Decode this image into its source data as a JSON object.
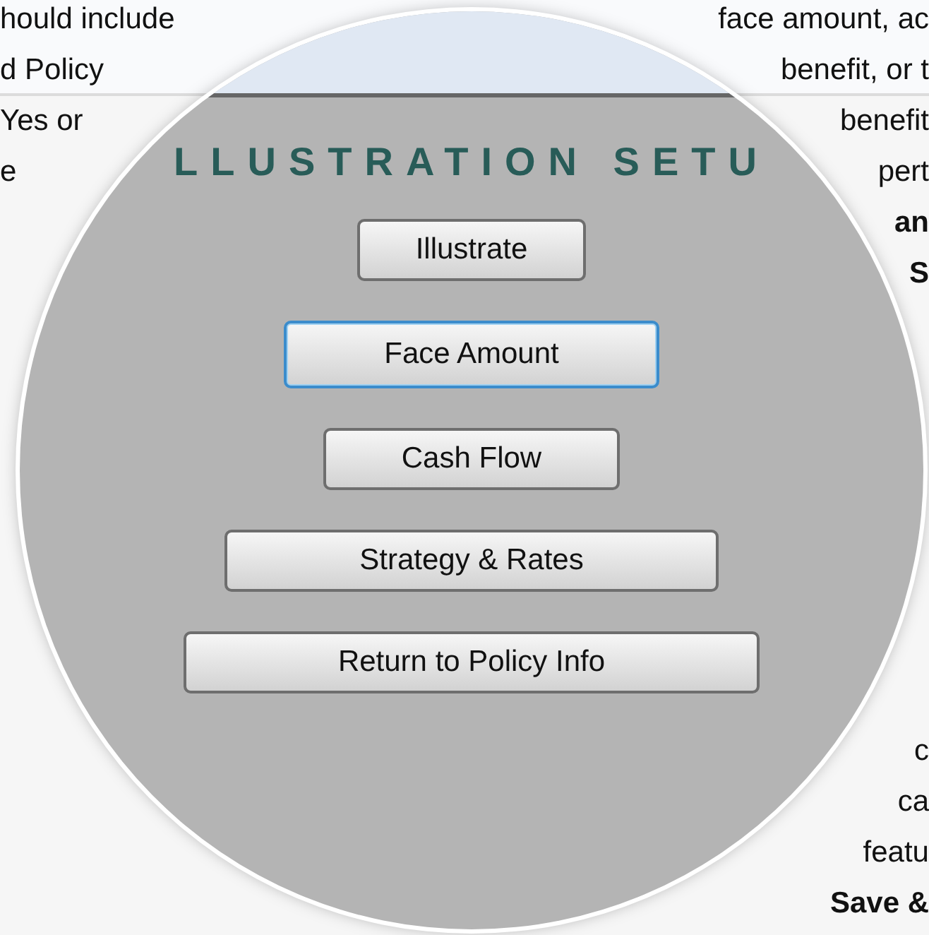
{
  "document": {
    "left_lines": [
      "hould include",
      "d Policy",
      "Yes or",
      "e"
    ],
    "right_lines_top": [
      {
        "text": "face amount, ac",
        "bold": false
      },
      {
        "text": "benefit, or t",
        "bold": false
      },
      {
        "text": "benefit",
        "bold": false
      },
      {
        "text": "pert",
        "bold": false
      },
      {
        "text": "an",
        "bold": true
      },
      {
        "text": "S",
        "bold": true
      }
    ],
    "right_lines_bottom": [
      {
        "text": "c",
        "bold": false
      },
      {
        "text": "ca",
        "bold": false
      },
      {
        "text": "featu",
        "bold": false
      },
      {
        "text": "Save &",
        "bold": true
      }
    ]
  },
  "panel": {
    "title": "LLUSTRATION SETU",
    "buttons": [
      {
        "label": "Illustrate",
        "focused": false
      },
      {
        "label": "Face Amount",
        "focused": true
      },
      {
        "label": "Cash Flow",
        "focused": false
      },
      {
        "label": "Strategy & Rates",
        "focused": false
      },
      {
        "label": "Return to Policy Info",
        "focused": false
      }
    ]
  }
}
